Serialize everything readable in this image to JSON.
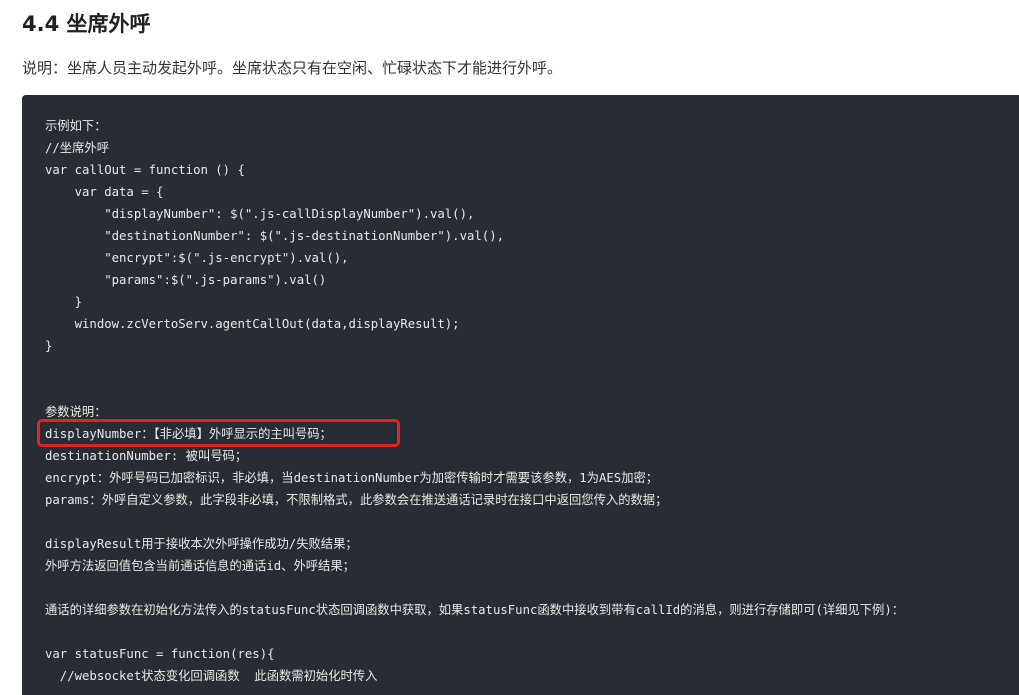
{
  "section": {
    "title": "4.4 坐席外呼",
    "description": "说明：坐席人员主动发起外呼。坐席状态只有在空闲、忙碌状态下才能进行外呼。"
  },
  "code": {
    "lines": [
      "示例如下：",
      "//坐席外呼",
      "var callOut = function () {",
      "    var data = {",
      "        \"displayNumber\": $(\".js-callDisplayNumber\").val(),",
      "        \"destinationNumber\": $(\".js-destinationNumber\").val(),",
      "        \"encrypt\":$(\".js-encrypt\").val(),",
      "        \"params\":$(\".js-params\").val()",
      "    }",
      "    window.zcVertoServ.agentCallOut(data,displayResult);",
      "}",
      "",
      "",
      "参数说明：",
      "displayNumber：【非必填】外呼显示的主叫号码；",
      "destinationNumber: 被叫号码；",
      "encrypt：外呼号码已加密标识，非必填，当destinationNumber为加密传输时才需要该参数，1为AES加密；",
      "params：外呼自定义参数，此字段非必填，不限制格式，此参数会在推送通话记录时在接口中返回您传入的数据；",
      "",
      "displayResult用于接收本次外呼操作成功/失败结果；",
      "外呼方法返回值包含当前通话信息的通话id、外呼结果；",
      "",
      "通话的详细参数在初始化方法传入的statusFunc状态回调函数中获取，如果statusFunc函数中接收到带有callId的消息，则进行存储即可(详细见下例)：",
      "",
      "var statusFunc = function(res){",
      "  //websocket状态变化回调函数  此函数需初始化时传入"
    ]
  },
  "colors": {
    "code_background": "#282c34",
    "code_text": "#e8e8e8",
    "highlight_border": "#e0251d"
  }
}
